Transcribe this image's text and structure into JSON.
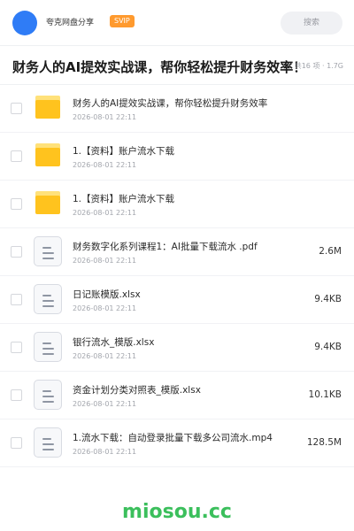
{
  "header": {
    "share_title": "夸克网盘分享",
    "badge": "SVIP",
    "search_label": "搜索",
    "accent_color": "#2f7cf6",
    "badge_color": "#ff9a2e"
  },
  "title_bar": {
    "title": "财务人的AI提效实战课，帮你轻松提升财务效率！",
    "meta": "共16 项 · 1.7G"
  },
  "files": [
    {
      "icon": "folder-icon",
      "name": "财务人的AI提效实战课，帮你轻松提升财务效率",
      "date": "2026-08-01 22:11",
      "size": ""
    },
    {
      "icon": "folder-icon",
      "name": "1.【资料】账户流水下载",
      "date": "2026-08-01 22:11",
      "size": ""
    },
    {
      "icon": "folder-icon",
      "name": "1.【资料】账户流水下载",
      "date": "2026-08-01 22:11",
      "size": ""
    },
    {
      "icon": "document-icon",
      "name": "财务数字化系列课程1：AI批量下载流水 .pdf",
      "date": "2026-08-01 22:11",
      "size": "2.6M"
    },
    {
      "icon": "document-icon",
      "name": "日记账模版.xlsx",
      "date": "2026-08-01 22:11",
      "size": "9.4KB"
    },
    {
      "icon": "document-icon",
      "name": "银行流水_模版.xlsx",
      "date": "2026-08-01 22:11",
      "size": "9.4KB"
    },
    {
      "icon": "document-icon",
      "name": "资金计划分类对照表_模版.xlsx",
      "date": "2026-08-01 22:11",
      "size": "10.1KB"
    },
    {
      "icon": "document-icon",
      "name": "1.流水下载：自动登录批量下载多公司流水.mp4",
      "date": "2026-08-01 22:11",
      "size": "128.5M"
    }
  ],
  "watermark": "miosou.cc",
  "watermark_color": "#3bbf5c"
}
